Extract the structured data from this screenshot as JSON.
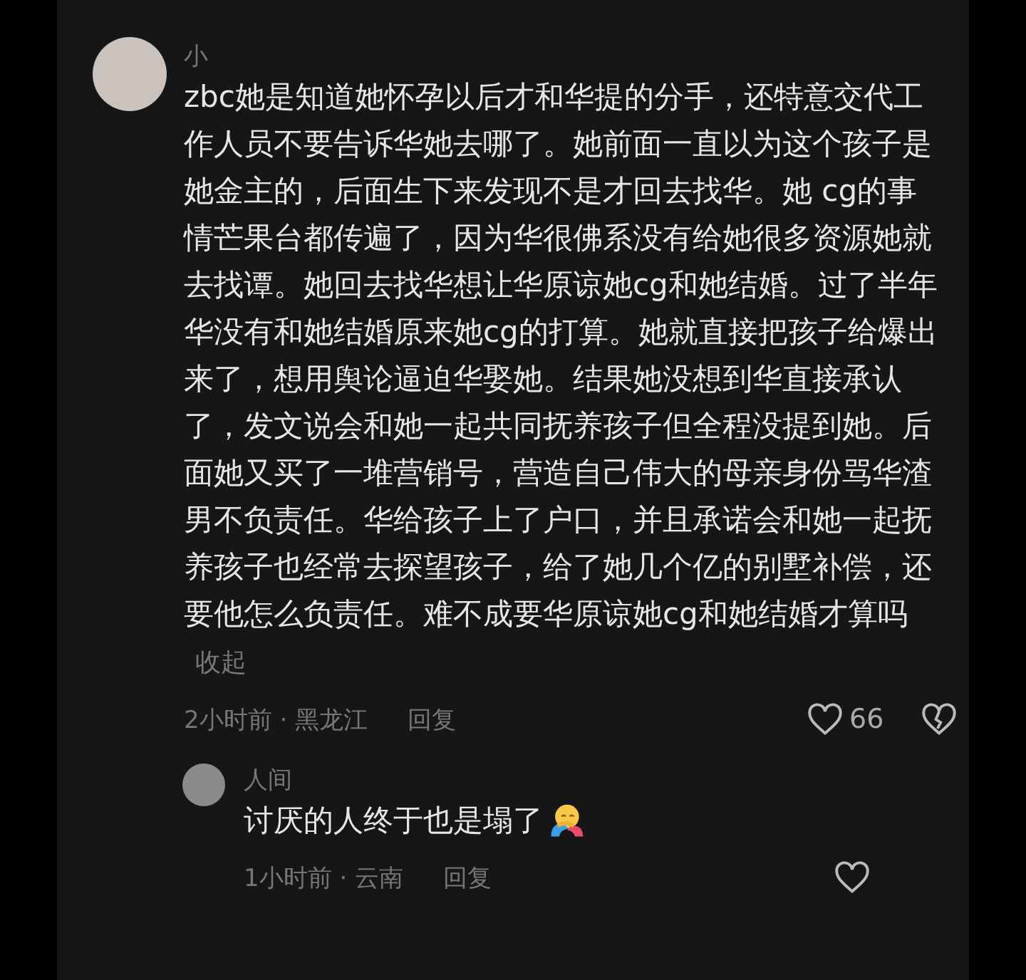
{
  "comments": [
    {
      "author": "小",
      "text": "zbc她是知道她怀孕以后才和华提的分手，还特意交代工作人员不要告诉华她去哪了。她前面一直以为这个孩子是她金主的，后面生下来发现不是才回去找华。她 cg的事情芒果台都传遍了，因为华很佛系没有给她很多资源她就去找谭。她回去找华想让华原谅她cg和她结婚。过了半年华没有和她结婚原来她cg的打算。她就直接把孩子给爆出来了，想用舆论逼迫华娶她。结果她没想到华直接承认了，发文说会和她一起共同抚养孩子但全程没提到她。后面她又买了一堆营销号，营造自己伟大的母亲身份骂华渣男不负责任。华给孩子上了户口，并且承诺会和她一起抚养孩子也经常去探望孩子，给了她几个亿的别墅补偿，还要他怎么负责任。难不成要华原谅她cg和她结婚才算吗",
      "collapse": "收起",
      "time": "2小时前 · 黑龙江",
      "reply": "回复",
      "likes": "66"
    },
    {
      "author": "人间",
      "text": "讨厌的人终于也是塌了",
      "time": "1小时前 · 云南",
      "reply": "回复"
    }
  ]
}
